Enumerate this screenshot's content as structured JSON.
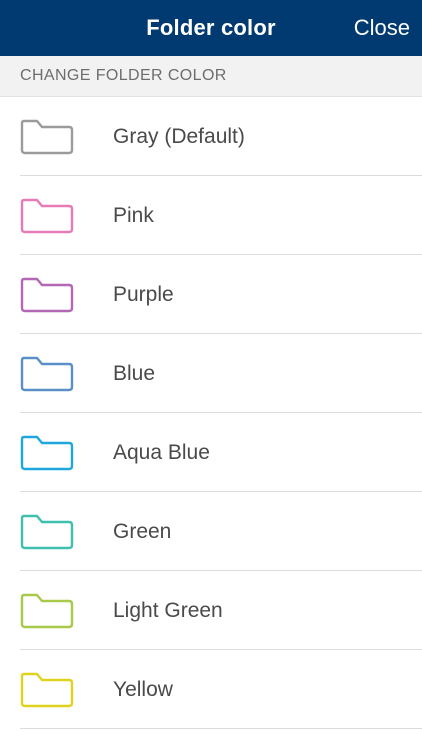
{
  "header": {
    "title": "Folder color",
    "close_label": "Close",
    "background": "#003a70"
  },
  "section": {
    "title": "CHANGE FOLDER COLOR"
  },
  "colors": [
    {
      "label": "Gray (Default)",
      "color": "#9b9b9b",
      "icon": "folder-icon"
    },
    {
      "label": "Pink",
      "color": "#e87bb5",
      "icon": "folder-icon"
    },
    {
      "label": "Purple",
      "color": "#b367b5",
      "icon": "folder-icon"
    },
    {
      "label": "Blue",
      "color": "#5b8fc7",
      "icon": "folder-icon"
    },
    {
      "label": "Aqua Blue",
      "color": "#1fa8e0",
      "icon": "folder-icon"
    },
    {
      "label": "Green",
      "color": "#3fbfad",
      "icon": "folder-icon"
    },
    {
      "label": "Light Green",
      "color": "#a9c94a",
      "icon": "folder-icon"
    },
    {
      "label": "Yellow",
      "color": "#e0d31f",
      "icon": "folder-icon"
    }
  ]
}
